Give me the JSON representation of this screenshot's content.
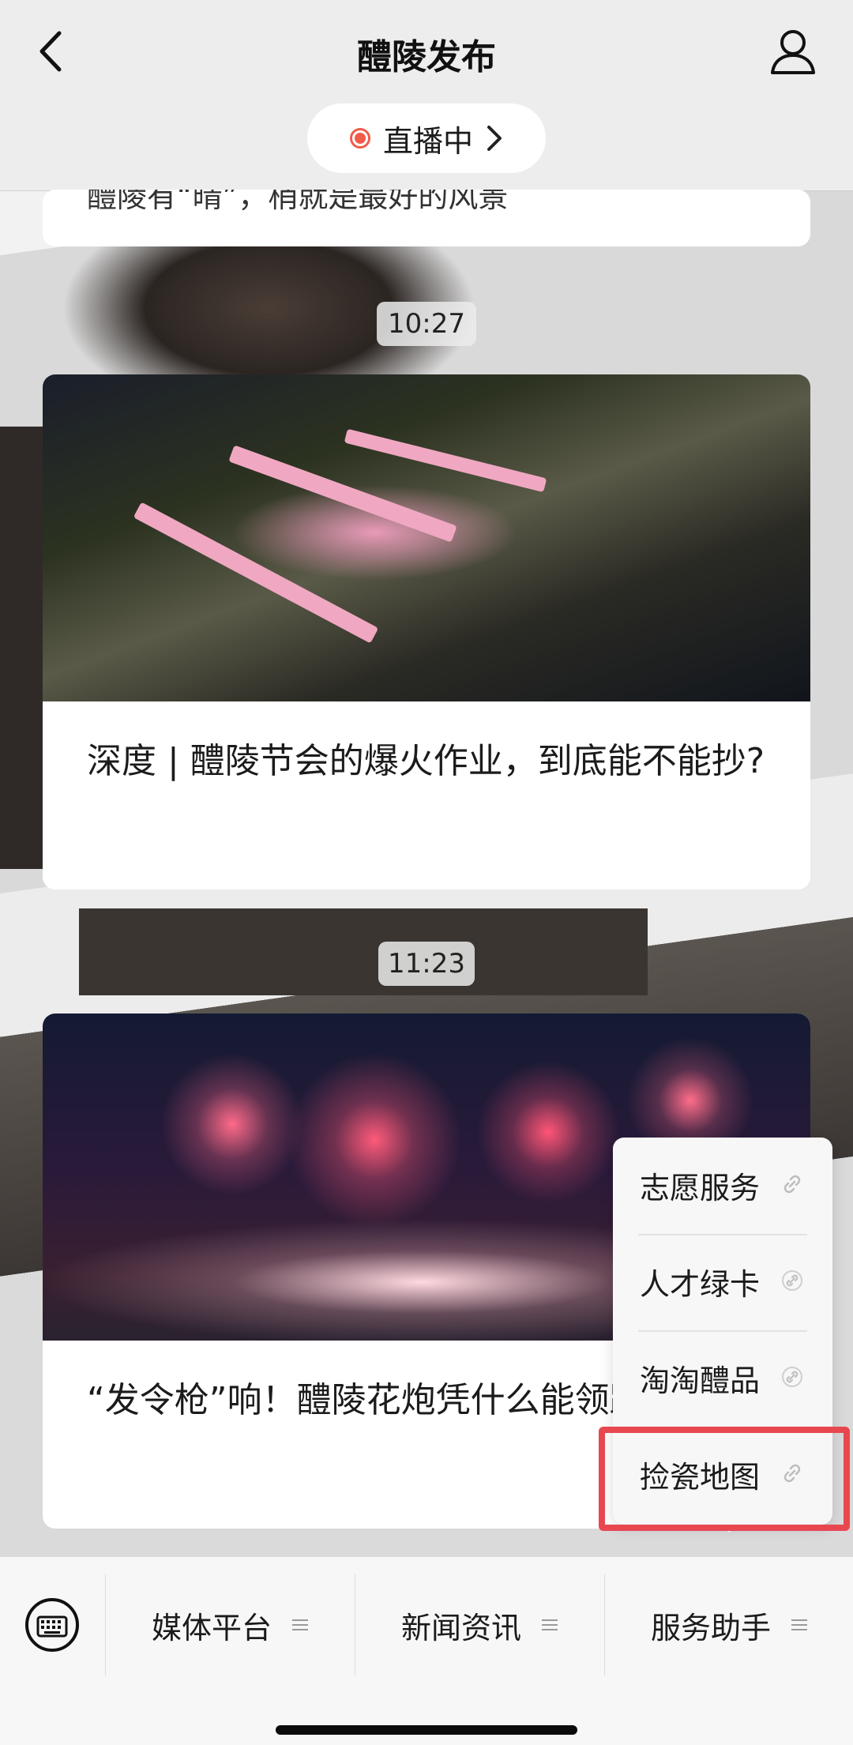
{
  "header": {
    "title": "醴陵发布",
    "live_label": "直播中"
  },
  "feed": {
    "partial_card_text": "醴陵有“晴”，梢就是最好的风景",
    "articles": [
      {
        "time": "10:27",
        "title": "深度 | 醴陵节会的爆火作业，到底能不能抄?"
      },
      {
        "time": "11:23",
        "title": "“发令枪”响！醴陵花炮凭什么能领跑?"
      }
    ]
  },
  "popup_menu": {
    "items": [
      {
        "label": "志愿服务",
        "icon": "link-icon"
      },
      {
        "label": "人才绿卡",
        "icon": "link-icon"
      },
      {
        "label": "淘淘醴品",
        "icon": "link-icon"
      },
      {
        "label": "捡瓷地图",
        "icon": "link-icon",
        "highlighted": true
      }
    ]
  },
  "bottom_bar": {
    "tabs": [
      {
        "label": "媒体平台"
      },
      {
        "label": "新闻资讯"
      },
      {
        "label": "服务助手"
      }
    ]
  },
  "colors": {
    "live_dot": "#f25a4a",
    "highlight": "#e8474f",
    "header_bg": "#ededed"
  }
}
